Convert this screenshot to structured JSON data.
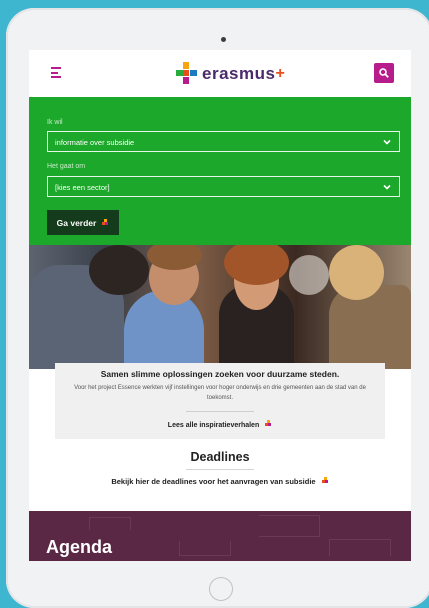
{
  "header": {
    "logo_text": "erasmus",
    "logo_plus": "+",
    "menu_icon": "hamburger-menu-icon",
    "search_icon": "search-icon"
  },
  "form": {
    "label_want": "Ik wil",
    "select_want": "informatie over subsidie",
    "label_sector": "Het gaat om",
    "select_sector": "[kies een sector]",
    "go_button": "Ga verder"
  },
  "story": {
    "title": "Samen slimme oplossingen zoeken voor duurzame steden.",
    "text": "Voor het project Essence werkten vijf instellingen voor hoger onderwijs en drie gemeenten aan de stad van de toekomst.",
    "link": "Lees alle inspiratieverhalen"
  },
  "deadlines": {
    "title": "Deadlines",
    "link": "Bekijk hier de deadlines voor het aanvragen van subsidie"
  },
  "agenda": {
    "title": "Agenda"
  },
  "colors": {
    "green": "#1ca82a",
    "magenta": "#b71c8c",
    "dark_green": "#143b1b",
    "agenda_bg": "#5a2744",
    "accent_orange": "#e84e1b"
  }
}
